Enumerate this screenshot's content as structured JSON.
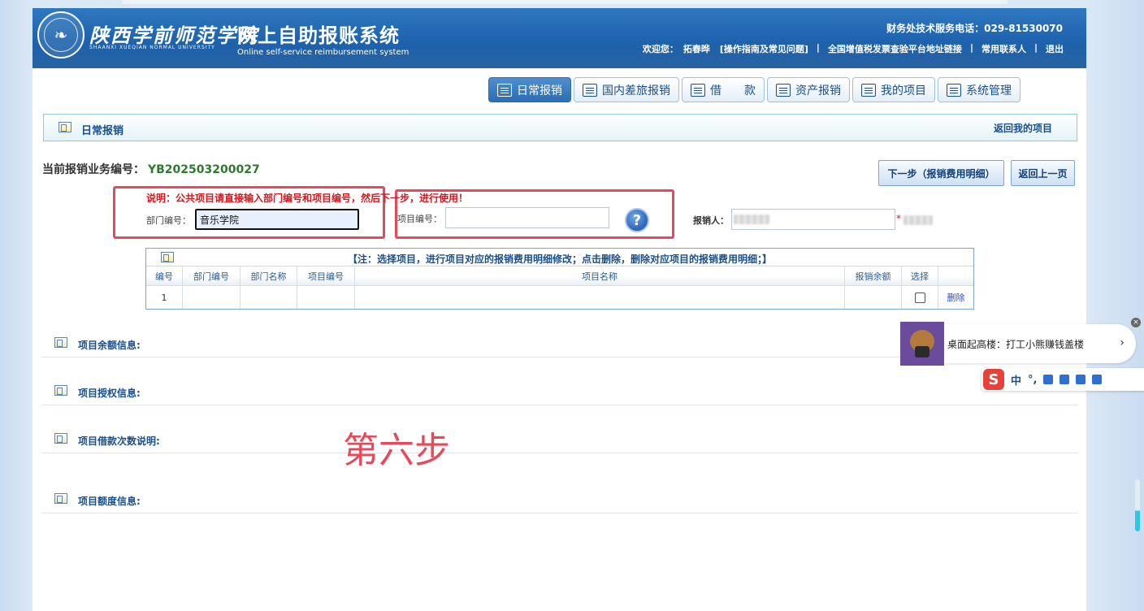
{
  "header": {
    "logo_cn": "陕西学前师范学院",
    "logo_en": "SHAANXI XUEQIAN NORMAL UNIVERSITY",
    "system_title": "网上自助报账系统",
    "system_subtitle": "Online self-service reimbursement system",
    "phone": "财务处技术服务电话：029-81530070",
    "welcome": "欢迎您：",
    "username": "拓春晔",
    "links": {
      "guide": "[操作指南及常见问题]",
      "vat": "全国增值税发票查验平台地址链接",
      "contacts": "常用联系人",
      "logout": "退出"
    },
    "sep": "|"
  },
  "tabs": [
    {
      "label": "日常报销",
      "icon": "ledger-icon"
    },
    {
      "label": "国内差旅报销",
      "icon": "train-icon"
    },
    {
      "label": "借　　款",
      "icon": "money-icon"
    },
    {
      "label": "资产报销",
      "icon": "coins-icon"
    },
    {
      "label": "我的项目",
      "icon": "list-icon"
    },
    {
      "label": "系统管理",
      "icon": "computer-icon"
    }
  ],
  "section": {
    "title": "日常报销",
    "back_link": "返回我的项目"
  },
  "business": {
    "label": "当前报销业务编号：",
    "number": "YB202503200027"
  },
  "buttons": {
    "next": "下一步（报销费用明细）",
    "back": "返回上一页"
  },
  "note": "说明：公共项目请直接输入部门编号和项目编号，然后下一步，进行使用！",
  "form": {
    "dept_label": "部门编号：",
    "dept_value": "音乐学院",
    "project_label": "项目编号：",
    "project_value": "",
    "help": "?",
    "reimburser_label": "报销人：",
    "required_mark": "*"
  },
  "table": {
    "note": "【注：选择项目，进行项目对应的报销费用明细修改；点击删除，删除对应项目的报销费用明细；】",
    "columns": [
      "编号",
      "部门编号",
      "部门名称",
      "项目编号",
      "项目名称",
      "报销余额",
      "选择",
      ""
    ],
    "rows": [
      {
        "no": "1",
        "dept_code": "",
        "dept_name": "",
        "project_code": "",
        "project_name": "",
        "balance": "",
        "action": "删除"
      }
    ]
  },
  "info_sections": [
    "项目余额信息:",
    "项目授权信息:",
    "项目借款次数说明:",
    "项目额度信息:"
  ],
  "annotation": "第六步",
  "ad": {
    "text": "桌面起高楼：打工小熊赚钱盖楼",
    "chevron": "›",
    "close": "×"
  },
  "ime": {
    "logo": "S",
    "mode": "中",
    "punct": "°,"
  },
  "colors": {
    "header_blue": "#1e63ad",
    "note_red": "#d4181f",
    "highlight_red": "#e8495a",
    "biz_green": "#2c7a2c"
  }
}
